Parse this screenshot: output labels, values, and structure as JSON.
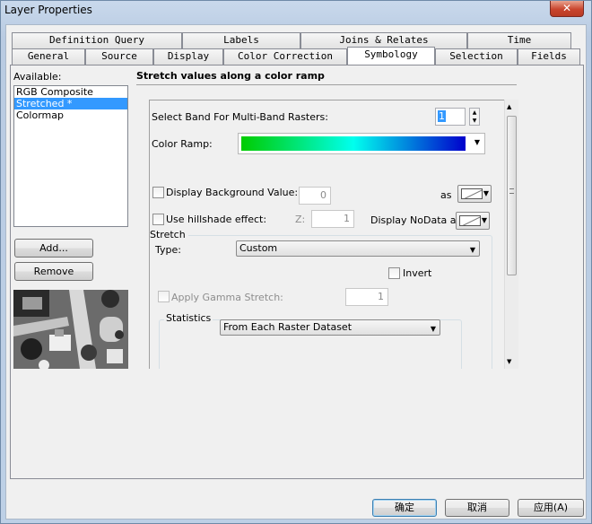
{
  "window": {
    "title": "Layer Properties",
    "close_glyph": "✕"
  },
  "tabs_back": [
    "Definition Query",
    "Labels",
    "Joins & Relates",
    "Time"
  ],
  "tabs_front": [
    "General",
    "Source",
    "Display",
    "Color Correction",
    "Symbology",
    "Selection",
    "Fields"
  ],
  "active_tab": "Symbology",
  "available": {
    "label": "Available:",
    "items": [
      "RGB Composite",
      "Stretched *",
      "Colormap"
    ],
    "selected": "Stretched *",
    "add_button": "Add...",
    "remove_button": "Remove"
  },
  "panel": {
    "heading": "Stretch values along a color ramp",
    "band_label": "Select Band For Multi-Band Rasters:",
    "band_value": "1",
    "color_ramp_label": "Color Ramp:",
    "color_ramp_colors": [
      "#00cc00",
      "#00ffee",
      "#0000cc"
    ],
    "display_background_label": "Display Background Value:",
    "display_background_value": "0",
    "as_label": "as",
    "hillshade_label": "Use hillshade effect:",
    "z_label": "Z:",
    "z_value": "1",
    "nodata_label": "Display NoData as",
    "stretch_group_label": "Stretch",
    "type_label": "Type:",
    "type_value": "Custom",
    "invert_label": "Invert",
    "gamma_label": "Apply Gamma Stretch:",
    "gamma_value": "1",
    "statistics_group_label": "Statistics",
    "statistics_value": "From Each Raster Dataset"
  },
  "buttons": {
    "ok": "确定",
    "cancel": "取消",
    "apply": "应用(A)"
  },
  "icons": {
    "dropdown": "chevron-down-icon",
    "spin_up": "spin-up-icon",
    "spin_down": "spin-down-icon"
  }
}
